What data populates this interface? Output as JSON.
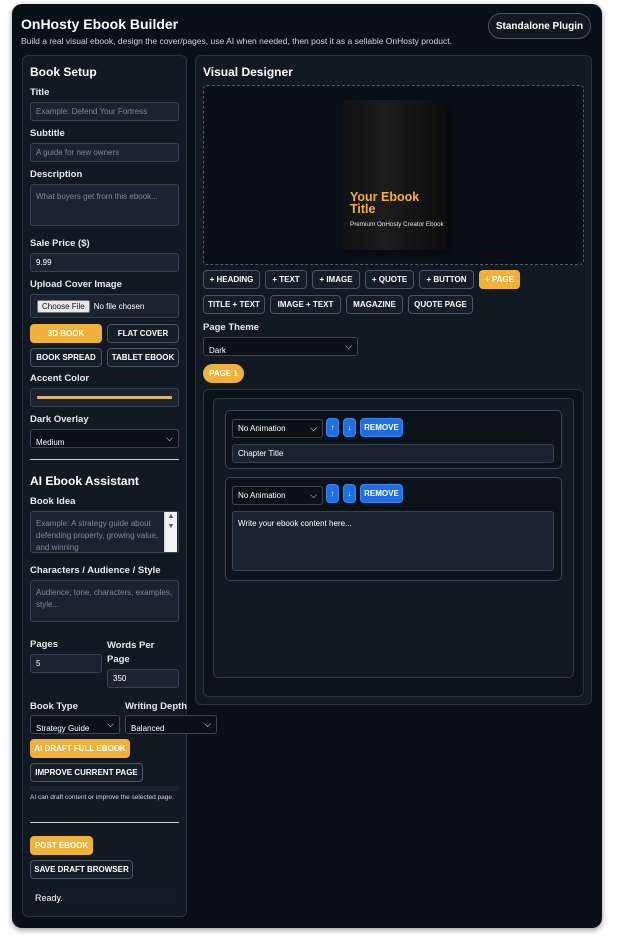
{
  "header": {
    "title": "OnHosty Ebook Builder",
    "subtitle": "Build a real visual ebook, design the cover/pages, use AI when needed, then post it as a sellable OnHosty product.",
    "badge": "Standalone Plugin"
  },
  "setup": {
    "heading": "Book Setup",
    "title_label": "Title",
    "title_placeholder": "Example: Defend Your Fortress",
    "subtitle_label": "Subtitle",
    "subtitle_placeholder": "A guide for new owners",
    "description_label": "Description",
    "description_placeholder": "What buyers get from this ebook...",
    "price_label": "Sale Price ($)",
    "price_value": "9.99",
    "cover_label": "Upload Cover Image",
    "choose_file": "Choose File",
    "no_file": "No file chosen",
    "cover_styles": [
      "3D BOOK",
      "FLAT COVER",
      "BOOK SPREAD",
      "TABLET EBOOK"
    ],
    "accent_label": "Accent Color",
    "accent_color": "#d9b36b",
    "overlay_label": "Dark Overlay",
    "overlay_value": "Medium"
  },
  "ai": {
    "heading": "AI Ebook Assistant",
    "idea_label": "Book Idea",
    "idea_placeholder": "Example: A strategy guide about defending property, growing value, and winning",
    "style_label": "Characters / Audience / Style",
    "style_placeholder": "Audience, tone, characters, examples, style...",
    "pages_label": "Pages",
    "pages_value": "5",
    "words_label": "Words Per Page",
    "words_value": "350",
    "type_label": "Book Type",
    "type_value": "Strategy Guide",
    "depth_label": "Writing Depth",
    "depth_value": "Balanced",
    "draft_button": "AI DRAFT FULL EBOOK",
    "improve_button": "IMPROVE CURRENT PAGE",
    "note": "AI can draft content or improve the selected page.",
    "post_button": "POST EBOOK",
    "save_button": "SAVE DRAFT BROWSER",
    "status": "Ready."
  },
  "designer": {
    "heading": "Visual Designer",
    "cover_title": "Your Ebook Title",
    "cover_subtitle": "Premium OnHosty Creator Ebook",
    "add_buttons": [
      "+ HEADING",
      "+ TEXT",
      "+ IMAGE",
      "+ QUOTE",
      "+ BUTTON",
      "+ PAGE"
    ],
    "layout_buttons": [
      "TITLE + TEXT",
      "IMAGE + TEXT",
      "MAGAZINE",
      "QUOTE PAGE"
    ],
    "theme_label": "Page Theme",
    "theme_value": "Dark",
    "page_tab": "PAGE 1",
    "blocks": [
      {
        "animation": "No Animation",
        "up": "↑",
        "down": "↓",
        "remove": "REMOVE",
        "content": "Chapter Title"
      },
      {
        "animation": "No Animation",
        "up": "↑",
        "down": "↓",
        "remove": "REMOVE",
        "content": "Write your ebook content here..."
      }
    ]
  }
}
